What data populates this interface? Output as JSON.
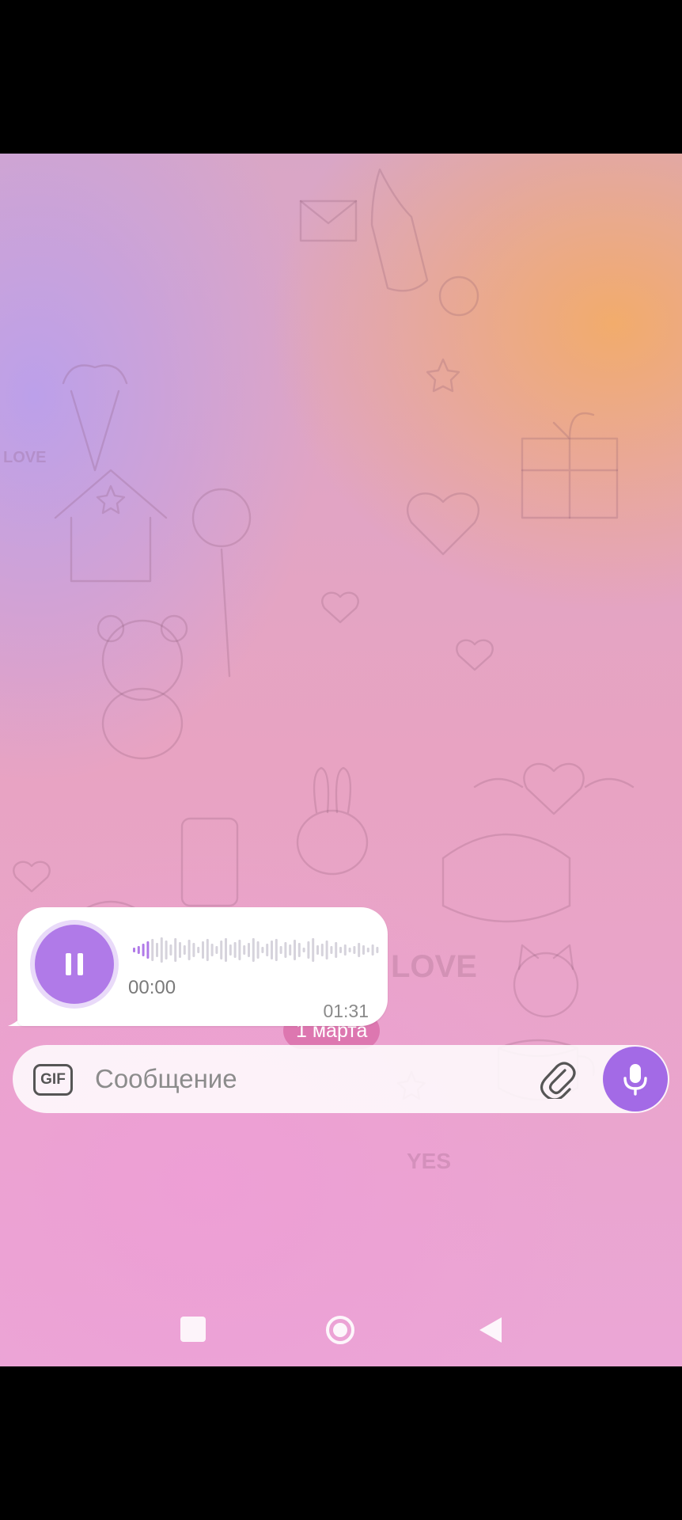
{
  "chat": {
    "date_label": "1 марта",
    "background_colors": {
      "purple": "#baa0ec",
      "orange": "#f3ac67",
      "pink": "#ee9ed6"
    },
    "voice_message": {
      "progress": 0,
      "elapsed": "00:00",
      "duration": "01:31",
      "state_icon": "pause-icon",
      "accent_color": "#b07ae8"
    },
    "doodle_text": {
      "love_1": "LOVE",
      "love_2": "LOVE",
      "yes": "YES"
    }
  },
  "composer": {
    "gif_label": "GIF",
    "placeholder": "Сообщение",
    "attach_icon": "paperclip-icon",
    "mic_icon": "microphone-icon",
    "mic_color": "#a36ae6"
  },
  "nav": {
    "recents_icon": "square-icon",
    "home_icon": "circle-icon",
    "back_icon": "triangle-back-icon"
  }
}
